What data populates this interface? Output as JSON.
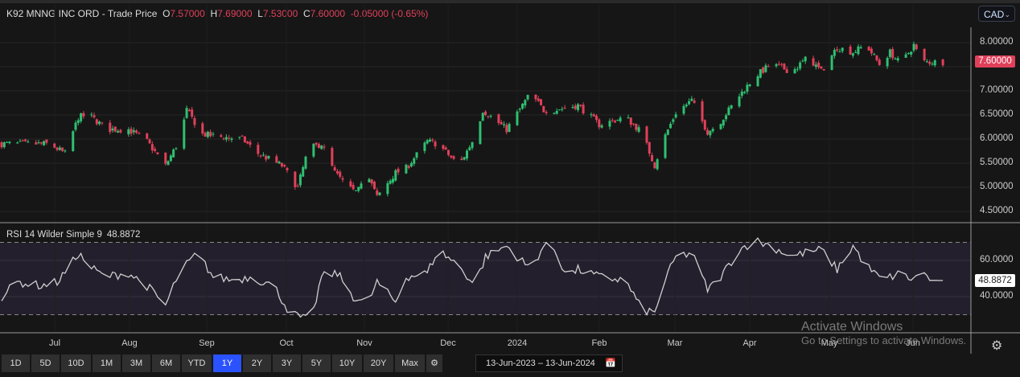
{
  "header": {
    "name": "K92 MNNG INC ORD",
    "sep": " - ",
    "type": "Trade Price",
    "o_label": "O",
    "o": "7.57000",
    "h_label": "H",
    "h": "7.69000",
    "l_label": "L",
    "l": "7.53000",
    "c_label": "C",
    "c": "7.60000",
    "change": "-0.05000 (-0.65%)"
  },
  "currency": {
    "selected": "CAD"
  },
  "price_axis": {
    "labels": [
      "8.00000",
      "7.00000",
      "6.50000",
      "6.00000",
      "5.50000",
      "5.00000",
      "4.50000"
    ],
    "last": "7.60000"
  },
  "rsi": {
    "title": "RSI 14 Wilder Simple 9",
    "value": "48.8872",
    "axis_labels": [
      "60.0000",
      "40.0000"
    ],
    "last": "48.8872"
  },
  "time_axis": [
    "Jul",
    "Aug",
    "Sep",
    "Oct",
    "Nov",
    "Dec",
    "2024",
    "Feb",
    "Mar",
    "Apr",
    "May",
    "Jun"
  ],
  "ranges": [
    "1D",
    "5D",
    "10D",
    "1M",
    "3M",
    "6M",
    "YTD",
    "1Y",
    "2Y",
    "3Y",
    "5Y",
    "10Y",
    "20Y",
    "Max"
  ],
  "active_range": "1Y",
  "date_range": {
    "from": "13-Jun-2023",
    "sep": "–",
    "to": "13-Jun-2024"
  },
  "watermark": {
    "line1": "Activate Windows",
    "line2": "Go to Settings to activate Windows."
  },
  "colors": {
    "up": "#2fbf71",
    "down": "#e0405a",
    "rsi_line": "#cfcfcf",
    "rsi_band": "#241f2d"
  },
  "chart_data": {
    "type": "candlestick",
    "start_date": "2023-06-13",
    "end_date": "2024-06-13",
    "ylim": [
      4.3,
      8.3
    ],
    "price_trend": {
      "days": [
        0,
        18,
        24,
        29,
        33,
        40,
        48,
        55,
        62,
        67,
        70,
        76,
        82,
        91,
        97,
        106,
        112,
        116,
        121,
        126,
        133,
        138,
        142,
        149,
        153,
        161,
        165,
        173,
        179,
        182,
        191,
        200,
        205,
        209,
        218,
        226,
        236,
        242,
        247,
        250,
        255,
        261,
        267,
        271,
        279,
        285,
        291,
        299,
        305,
        310,
        316,
        322,
        327,
        332,
        336,
        340,
        345,
        348,
        351,
        356
      ],
      "close": [
        5.9,
        5.9,
        5.7,
        6.45,
        6.5,
        6.2,
        6.2,
        5.95,
        5.45,
        5.95,
        6.6,
        6.1,
        6.05,
        6.0,
        5.7,
        5.45,
        5.0,
        5.8,
        5.9,
        5.3,
        4.9,
        5.3,
        4.8,
        5.3,
        5.4,
        5.95,
        5.9,
        5.45,
        6.05,
        6.6,
        6.2,
        6.95,
        6.6,
        6.6,
        6.7,
        6.3,
        6.45,
        6.15,
        5.45,
        5.95,
        6.55,
        6.8,
        6.15,
        6.3,
        6.9,
        7.3,
        7.55,
        7.4,
        7.7,
        7.4,
        7.9,
        7.8,
        7.95,
        7.55,
        7.8,
        7.55,
        7.95,
        7.6,
        7.6,
        7.6
      ]
    },
    "rsi_trend": {
      "days": [
        0,
        6,
        15,
        21,
        26,
        29,
        33,
        39,
        48,
        55,
        62,
        67,
        74,
        80,
        88,
        94,
        103,
        109,
        117,
        121,
        127,
        133,
        138,
        142,
        149,
        153,
        161,
        165,
        173,
        179,
        183,
        191,
        200,
        205,
        209,
        214,
        218,
        226,
        236,
        242,
        247,
        250,
        255,
        261,
        267,
        271,
        279,
        285,
        291,
        299,
        303,
        310,
        316,
        322,
        327,
        333,
        340,
        345,
        348,
        351,
        356
      ],
      "rsi": [
        40,
        48,
        46,
        48,
        57,
        64,
        57,
        51,
        53,
        46,
        35,
        53,
        64,
        51,
        49,
        51,
        46,
        31,
        26,
        51,
        53,
        40,
        35,
        48,
        37,
        51,
        53,
        66,
        57,
        46,
        62,
        68,
        55,
        68,
        66,
        51,
        55,
        51,
        49,
        33,
        31,
        46,
        62,
        64,
        44,
        49,
        66,
        71,
        68,
        62,
        64,
        66,
        55,
        68,
        57,
        49,
        53,
        49,
        57,
        49,
        48.9
      ]
    }
  }
}
